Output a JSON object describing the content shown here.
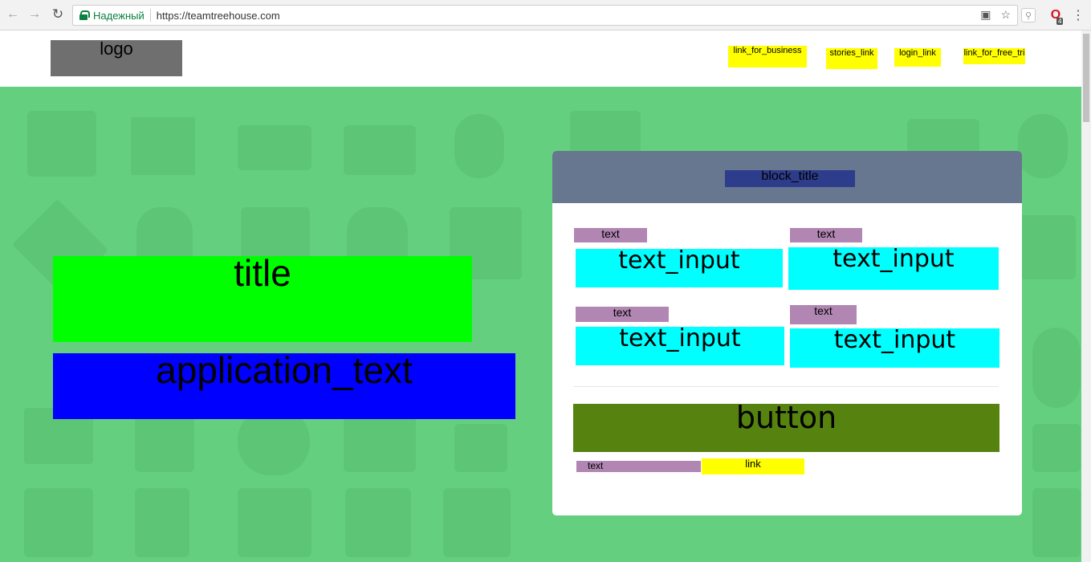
{
  "browser": {
    "secure_label": "Надежный",
    "url": "https://teamtreehouse.com",
    "back_icon": "arrow-left-icon",
    "forward_icon": "arrow-right-icon",
    "reload_icon": "reload-icon",
    "opera_badge": "4"
  },
  "header": {
    "logo": "logo",
    "nav": {
      "business": "link_for_business",
      "stories": "stories_link",
      "login": "login_link",
      "free_trial": "link_for_free_tri"
    }
  },
  "hero": {
    "title": "title",
    "application_text": "application_text"
  },
  "form": {
    "block_title": "block_title",
    "fields": [
      {
        "label": "text",
        "input": "text_input"
      },
      {
        "label": "text",
        "input": "text_input"
      },
      {
        "label": "text",
        "input": "text_input"
      },
      {
        "label": "text",
        "input": "text_input"
      }
    ],
    "button": "button",
    "footer_text": "text",
    "footer_link": "link"
  },
  "colors": {
    "hero_bg": "#64d07f",
    "card_header": "#66778f",
    "title_bg": "#00ff00",
    "app_text_bg": "#0000ff",
    "input_bg": "#00ffff",
    "label_bg": "#b186b3",
    "link_bg": "#ffff00",
    "button_bg": "#568210"
  }
}
